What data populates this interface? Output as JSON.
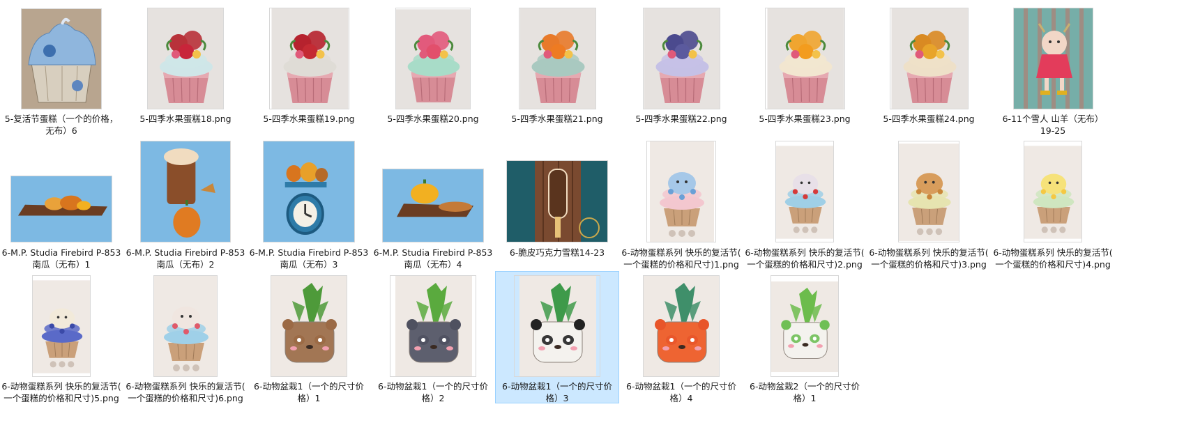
{
  "folder": {
    "items": [
      {
        "label": "5-复活节蛋糕（一个的价格，\n无布）6",
        "icon": "thumbnail-easter-blue-cupcake",
        "bg": "#b8a58f",
        "accent": "#8fb6dd",
        "kind": "cupcake-blue",
        "selected": false
      },
      {
        "label": "5-四季水果蛋糕18.png",
        "icon": "thumbnail-fruit-cupcake",
        "bg": "#e6e2df",
        "accent": "#c8253a",
        "kind": "cupcake",
        "top": "#b8323a",
        "cream": "#cfe6e8",
        "selected": false
      },
      {
        "label": "5-四季水果蛋糕19.png",
        "icon": "thumbnail-fruit-cupcake",
        "bg": "#e6e2df",
        "accent": "#c42a33",
        "kind": "cupcake",
        "top": "#b6222e",
        "cream": "#dfdcd6",
        "selected": false
      },
      {
        "label": "5-四季水果蛋糕20.png",
        "icon": "thumbnail-fruit-cupcake",
        "bg": "#e6e2df",
        "accent": "#e24f6c",
        "kind": "cupcake",
        "top": "#e25a7c",
        "cream": "#a8dcc8",
        "selected": false
      },
      {
        "label": "5-四季水果蛋糕21.png",
        "icon": "thumbnail-fruit-cupcake",
        "bg": "#e6e2df",
        "accent": "#ee7b22",
        "kind": "cupcake",
        "top": "#e87a2a",
        "cream": "#a9c9c0",
        "selected": false
      },
      {
        "label": "5-四季水果蛋糕22.png",
        "icon": "thumbnail-fruit-cupcake",
        "bg": "#e6e2df",
        "accent": "#5b5a9e",
        "kind": "cupcake",
        "top": "#4b4a8e",
        "cream": "#c5c1e6",
        "selected": false
      },
      {
        "label": "5-四季水果蛋糕23.png",
        "icon": "thumbnail-fruit-cupcake",
        "bg": "#e6e2df",
        "accent": "#f39c1e",
        "kind": "cupcake",
        "top": "#f0a530",
        "cream": "#f2e6d0",
        "selected": false
      },
      {
        "label": "5-四季水果蛋糕24.png",
        "icon": "thumbnail-fruit-cupcake",
        "bg": "#e6e2df",
        "accent": "#e8a42a",
        "kind": "cupcake",
        "top": "#d98a22",
        "cream": "#eee0c8",
        "selected": false
      },
      {
        "label": "6-11个雪人 山羊（无布）\n19-25",
        "icon": "thumbnail-goat-on-wood",
        "bg": "#7fb8b2",
        "accent": "#e33c5b",
        "kind": "wood",
        "selected": false
      },
      {
        "label": "6-M.P. Studia Firebird P-853\n南瓜（无布）1",
        "icon": "thumbnail-pumpkin-basket",
        "bg": "#6cb0e0",
        "accent": "#e9a23a",
        "kind": "pumpkin",
        "selected": false
      },
      {
        "label": "6-M.P. Studia Firebird P-853\n南瓜（无布）2",
        "icon": "thumbnail-pumpkin-drink",
        "bg": "#6cb0e0",
        "accent": "#e07b22",
        "kind": "pumpkin",
        "selected": false
      },
      {
        "label": "6-M.P. Studia Firebird P-853\n南瓜（无布）3",
        "icon": "thumbnail-pumpkin-scale",
        "bg": "#6cb0e0",
        "accent": "#d8751e",
        "kind": "pumpkin",
        "selected": false
      },
      {
        "label": "6-M.P. Studia Firebird P-853\n南瓜（无布）4",
        "icon": "thumbnail-pumpkin-pie",
        "bg": "#6cb0e0",
        "accent": "#f2b021",
        "kind": "pumpkin",
        "selected": false
      },
      {
        "label": "6-脆皮巧克力雪糕14-23",
        "icon": "thumbnail-chocolate-ice-cream",
        "bg": "#1f5d68",
        "accent": "#5a341e",
        "kind": "icecream",
        "selected": false
      },
      {
        "label": "6-动物蛋糕系列 快乐的复活节(\n一个蛋糕的价格和尺寸)1.png",
        "icon": "thumbnail-animal-cupcake",
        "bg": "#efe9e4",
        "accent": "#6aa0d6",
        "kind": "tall-cupcake",
        "top": "#a6c8e8",
        "cream": "#f3c7cf",
        "selected": false
      },
      {
        "label": "6-动物蛋糕系列 快乐的复活节(\n一个蛋糕的价格和尺寸)2.png",
        "icon": "thumbnail-animal-cupcake",
        "bg": "#efe9e4",
        "accent": "#d63a3a",
        "kind": "tall-cupcake",
        "top": "#e8e0e8",
        "cream": "#9fcfe6",
        "selected": false
      },
      {
        "label": "6-动物蛋糕系列 快乐的复活节(\n一个蛋糕的价格和尺寸)3.png",
        "icon": "thumbnail-animal-cupcake",
        "bg": "#efe9e4",
        "accent": "#c9873a",
        "kind": "tall-cupcake",
        "top": "#d89d5c",
        "cream": "#e6e4b0",
        "selected": false
      },
      {
        "label": "6-动物蛋糕系列 快乐的复活节(\n一个蛋糕的价格和尺寸)4.png",
        "icon": "thumbnail-animal-cupcake",
        "bg": "#efe9e4",
        "accent": "#f5c842",
        "kind": "tall-cupcake",
        "top": "#f6e27a",
        "cream": "#cfe6c0",
        "selected": false
      },
      {
        "label": "6-动物蛋糕系列 快乐的复活节(\n一个蛋糕的价格和尺寸)5.png",
        "icon": "thumbnail-animal-cupcake",
        "bg": "#efe9e4",
        "accent": "#3b4aa8",
        "kind": "tall-cupcake",
        "top": "#f2eada",
        "cream": "#5a6ac8",
        "selected": false
      },
      {
        "label": "6-动物蛋糕系列 快乐的复活节(\n一个蛋糕的价格和尺寸)6.png",
        "icon": "thumbnail-animal-cupcake",
        "bg": "#efe9e4",
        "accent": "#e05a6a",
        "kind": "tall-cupcake",
        "top": "#f0e6e0",
        "cream": "#9fd0e8",
        "selected": false
      },
      {
        "label": "6-动物盆栽1（一个的尺寸价\n格）1",
        "icon": "thumbnail-bear-planter",
        "bg": "#efe9e4",
        "accent": "#9b6a45",
        "kind": "planter",
        "face": "#a27654",
        "plant": "#4e9a3a",
        "selected": false
      },
      {
        "label": "6-动物盆栽1（一个的尺寸价\n格）2",
        "icon": "thumbnail-raccoon-planter",
        "bg": "#efe9e4",
        "accent": "#4f5160",
        "kind": "planter",
        "face": "#5d5f6e",
        "plant": "#5aaa3e",
        "selected": false
      },
      {
        "label": "6-动物盆栽1（一个的尺寸价\n格）3",
        "icon": "thumbnail-panda-planter",
        "bg": "#efe9e4",
        "accent": "#222222",
        "kind": "planter",
        "face": "#f4f2ee",
        "plant": "#3e9a4a",
        "selected": true
      },
      {
        "label": "6-动物盆栽1（一个的尺寸价\n格）4",
        "icon": "thumbnail-fox-planter",
        "bg": "#efe9e4",
        "accent": "#e8552a",
        "kind": "planter",
        "face": "#ee6432",
        "plant": "#3f8f6a",
        "selected": false
      },
      {
        "label": "6-动物盆栽2（一个的尺寸价\n格）1",
        "icon": "thumbnail-cat-planter",
        "bg": "#efe9e4",
        "accent": "#6fbf55",
        "kind": "planter",
        "face": "#f4f2ee",
        "plant": "#6cbc4c",
        "selected": false
      }
    ]
  }
}
